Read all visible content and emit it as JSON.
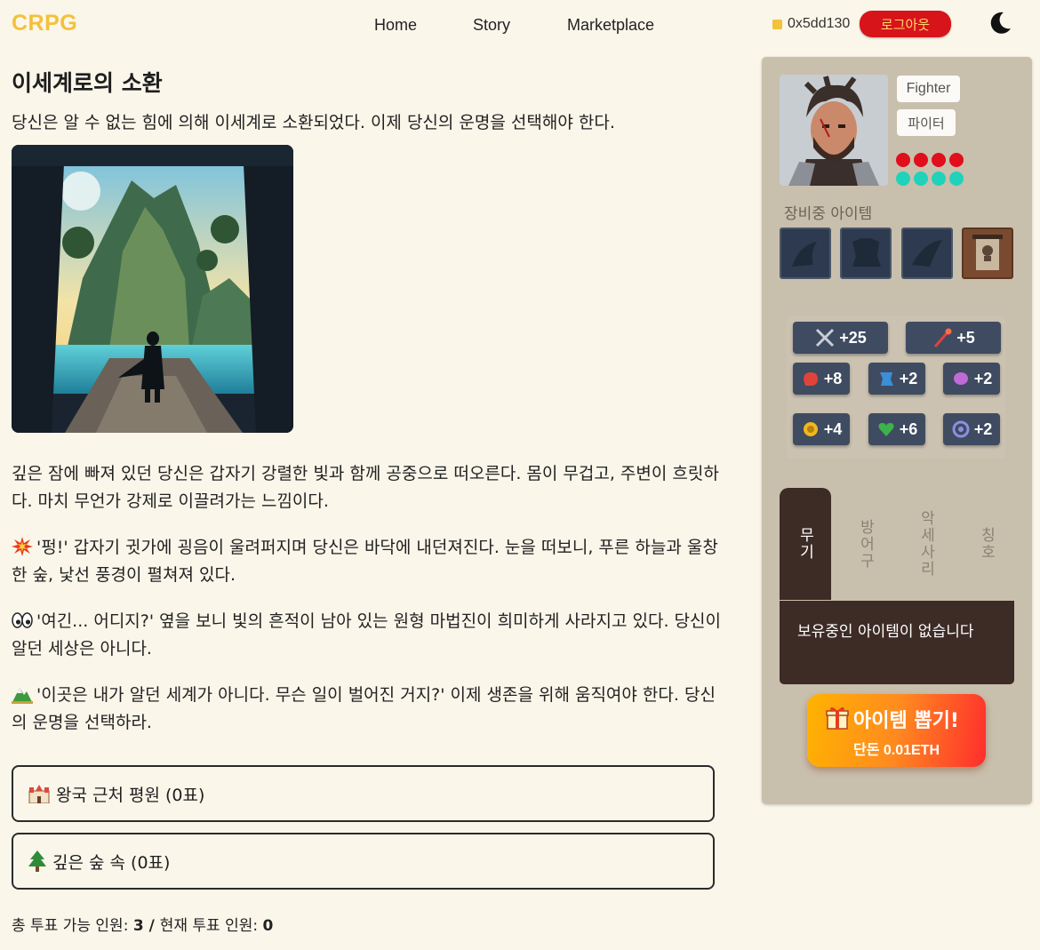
{
  "header": {
    "logo": "CRPG",
    "nav": [
      "Home",
      "Story",
      "Marketplace"
    ],
    "wallet": "0x5dd130",
    "logout_label": "로그아웃",
    "theme_icon": "moon-icon"
  },
  "story": {
    "title": "이세계로의 소환",
    "intro": "당신은 알 수 없는 힘에 의해 이세계로 소환되었다. 이제 당신의 운명을 선택해야 한다.",
    "paragraphs": [
      "깊은 잠에 빠져 있던 당신은 갑자기 강렬한 빛과 함께 공중으로 떠오른다. 몸이 무겁고, 주변이 흐릿하다. 마치 무언가 강제로 이끌려가는 느낌이다.",
      "'펑!' 갑자기 귓가에 굉음이 울려퍼지며 당신은 바닥에 내던져진다. 눈을 떠보니, 푸른 하늘과 울창한 숲, 낯선 풍경이 펼쳐져 있다.",
      "'여긴... 어디지?' 옆을 보니 빛의 흔적이 남아 있는 원형 마법진이 희미하게 사라지고 있다. 당신이 알던 세상은 아니다.",
      "'이곳은 내가 알던 세계가 아니다. 무슨 일이 벌어진 거지?' 이제 생존을 위해 움직여야 한다. 당신의 운명을 선택하라."
    ],
    "choices": [
      "왕국 근처 평원 (0표)",
      "깊은 숲 속 (0표)"
    ],
    "vote": {
      "total_label": "총 투표 가능 인원: ",
      "total": "3",
      "sep": " / ",
      "current_label": "현재 투표 인원: ",
      "current": "0"
    }
  },
  "character": {
    "class_en": "Fighter",
    "class_ko": "파이터",
    "equip_label": "장비중 아이템",
    "stats": {
      "attack": "+25",
      "magic": "+5",
      "s3": "+8",
      "s4": "+2",
      "s5": "+2",
      "s6": "+4",
      "s7": "+6",
      "s8": "+2"
    },
    "tabs": [
      "무기",
      "방어구",
      "악세사리",
      "칭호"
    ],
    "inventory_empty": "보유중인 아이템이 없습니다",
    "gacha_title": "아이템 뽑기!",
    "gacha_price": "단돈 0.01ETH"
  },
  "colors": {
    "accent_gold": "#f3c13a",
    "logout_red": "#d7141a",
    "sidebar": "#c9bfad",
    "panel_dark": "#3d2b26"
  }
}
